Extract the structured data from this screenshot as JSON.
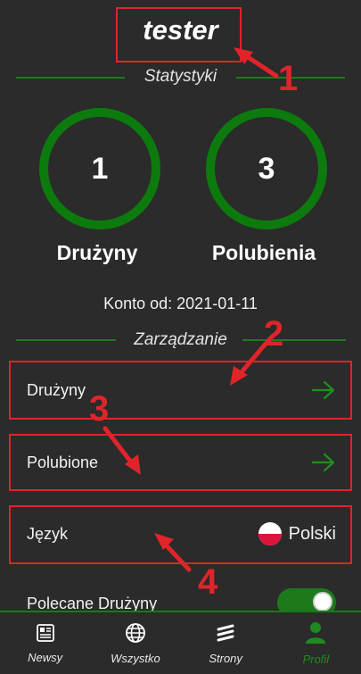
{
  "profile": {
    "username": "tester"
  },
  "stats": {
    "section_title": "Statystyki",
    "teams_count": "1",
    "teams_label": "Drużyny",
    "likes_count": "3",
    "likes_label": "Polubienia",
    "account_since": "Konto od: 2021-01-11"
  },
  "manage": {
    "section_title": "Zarządzanie",
    "teams": "Drużyny",
    "liked": "Polubione",
    "language_label": "Język",
    "language_value": "Polski",
    "recommended_teams": "Polecane Drużyny",
    "recommended_enabled": true
  },
  "nav": {
    "items": [
      {
        "label": "Newsy",
        "icon": "newspaper-icon"
      },
      {
        "label": "Wszystko",
        "icon": "globe-icon"
      },
      {
        "label": "Strony",
        "icon": "stack-icon"
      },
      {
        "label": "Profil",
        "icon": "user-icon",
        "active": true
      }
    ]
  },
  "annotations": [
    "1",
    "2",
    "3",
    "4"
  ],
  "colors": {
    "accent": "#0d7a0d",
    "annotation": "#e0242a",
    "background": "#2a2b2a"
  }
}
